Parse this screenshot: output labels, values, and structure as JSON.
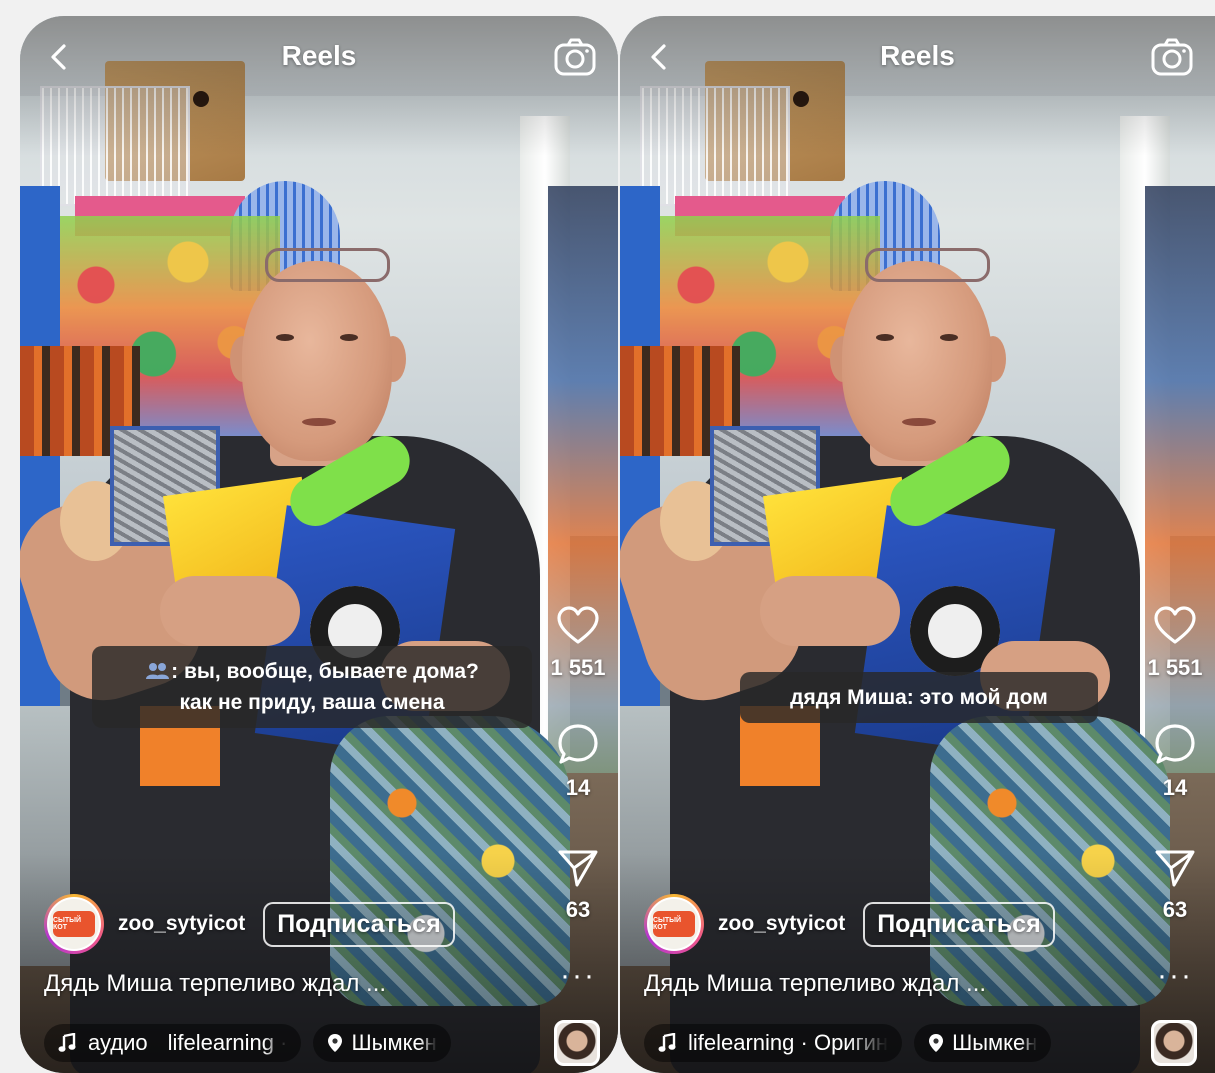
{
  "screens": [
    {
      "header_title": "Reels",
      "likes": "1 551",
      "comments": "14",
      "shares": "63",
      "caption_lines": [
        "вы, вообще, бываете дома?",
        "как не приду, ваша смена"
      ],
      "caption_prefix": ":",
      "username": "zoo_sytyicot",
      "follow_label": "Подписаться",
      "description": "Дядь Миша терпеливо ждал ...",
      "audio_label": "аудио",
      "audio_source": "lifelearning ·",
      "location": "Шымкен",
      "avatar_logo_text": "СЫТЫЙ КОТ"
    },
    {
      "header_title": "Reels",
      "likes": "1 551",
      "comments": "14",
      "shares": "63",
      "caption_lines": [
        "дядя Миша: это мой дом"
      ],
      "username": "zoo_sytyicot",
      "follow_label": "Подписаться",
      "description": "Дядь Миша терпеливо ждал ...",
      "audio_source": "lifelearning · Оригин",
      "location": "Шымкен",
      "avatar_logo_text": "СЫТЫЙ КОТ"
    }
  ],
  "colors": {
    "page_background": "#f1f1f1",
    "overlay_text": "#ffffff",
    "caption_bubble": "#282828",
    "avatar_ring": "#f0568b"
  },
  "icons": [
    "back-chevron-icon",
    "camera-icon",
    "heart-icon",
    "comment-icon",
    "share-paper-plane-icon",
    "more-dots-icon",
    "music-note-icon",
    "location-pin-icon",
    "people-icon"
  ]
}
